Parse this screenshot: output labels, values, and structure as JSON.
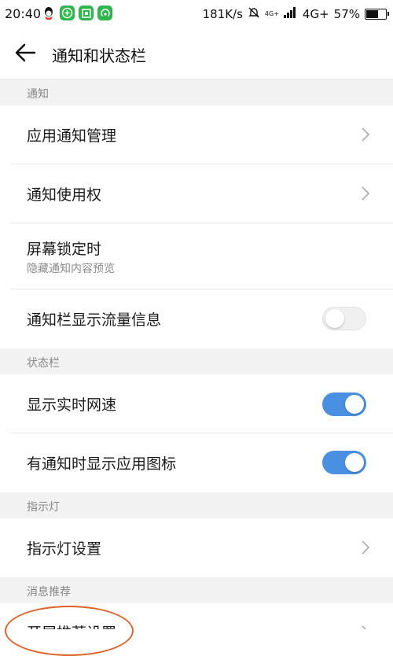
{
  "status_bar": {
    "time": "20:40",
    "speed": "181K/s",
    "network_small": "4G+",
    "network": "4G+",
    "battery": "57%",
    "battery_level": 0.57,
    "app_icons": [
      "qq-icon",
      "wechat-plus-icon",
      "scan-icon",
      "hotspot-icon"
    ]
  },
  "header": {
    "title": "通知和状态栏",
    "back_icon": "back-arrow-icon"
  },
  "sections": {
    "notify": {
      "title": "通知"
    },
    "statusbar": {
      "title": "状态栏"
    },
    "indicator": {
      "title": "指示灯"
    },
    "recommend": {
      "title": "消息推荐"
    }
  },
  "rows": {
    "app_notify": {
      "label": "应用通知管理"
    },
    "notify_permission": {
      "label": "通知使用权"
    },
    "lock_screen": {
      "label": "屏幕锁定时",
      "subtitle": "隐藏通知内容预览"
    },
    "traffic_info": {
      "label": "通知栏显示流量信息",
      "enabled": false
    },
    "net_speed": {
      "label": "显示实时网速",
      "enabled": true
    },
    "app_icon": {
      "label": "有通知时显示应用图标",
      "enabled": true
    },
    "indicator_settings": {
      "label": "指示灯设置"
    },
    "recommend_settings": {
      "label": "开屏推荐设置"
    }
  },
  "colors": {
    "accent": "#4a90e2",
    "annotation": "#e0622a",
    "section_bg": "#f2f2f2"
  }
}
